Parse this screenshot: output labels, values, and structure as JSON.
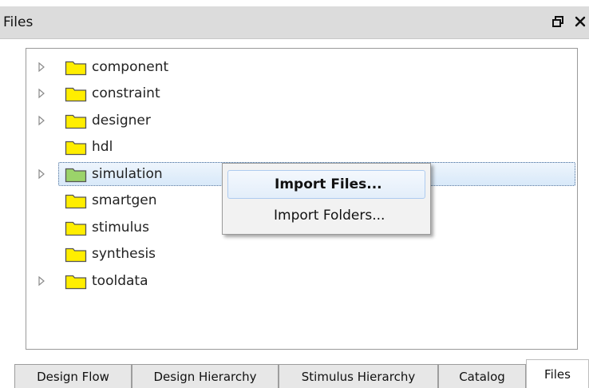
{
  "window": {
    "title": "Files"
  },
  "tree": {
    "items": [
      {
        "label": "component",
        "expandable": true
      },
      {
        "label": "constraint",
        "expandable": true
      },
      {
        "label": "designer",
        "expandable": true
      },
      {
        "label": "hdl",
        "expandable": false
      },
      {
        "label": "simulation",
        "expandable": true,
        "selected": true
      },
      {
        "label": "smartgen",
        "expandable": false
      },
      {
        "label": "stimulus",
        "expandable": false
      },
      {
        "label": "synthesis",
        "expandable": false
      },
      {
        "label": "tooldata",
        "expandable": true
      }
    ]
  },
  "context_menu": {
    "items": [
      {
        "label": "Import Files..."
      },
      {
        "label": "Import Folders..."
      }
    ]
  },
  "tabs": [
    {
      "label": "Design Flow"
    },
    {
      "label": "Design Hierarchy"
    },
    {
      "label": "Stimulus Hierarchy"
    },
    {
      "label": "Catalog"
    },
    {
      "label": "Files",
      "active": true
    }
  ],
  "colors": {
    "folder_fill": "#ffee00",
    "folder_selected_fill": "#9bd36a",
    "selection_border": "#4a6e9a"
  }
}
